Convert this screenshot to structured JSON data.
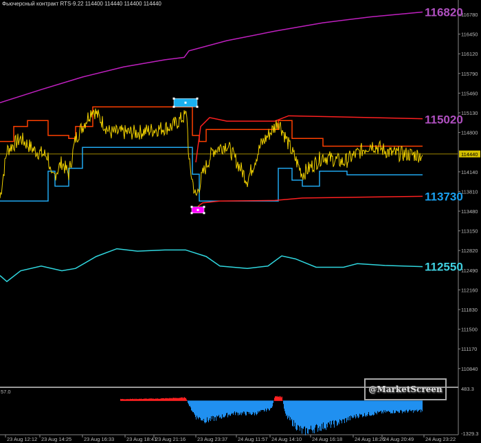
{
  "header": {
    "title": "Фьючерсный контракт RTS-9.22  114400 114440 114400 114440"
  },
  "logo_text": "@MarketScreen",
  "chart_data": {
    "type": "line",
    "title": "Фьючерсный контракт RTS-9.22",
    "x_unit": "bar index",
    "x_ticks": [
      {
        "bar": 8,
        "label": "23 Aug 12:12"
      },
      {
        "bar": 58,
        "label": "23 Aug 14:25"
      },
      {
        "bar": 120,
        "label": "23 Aug 16:33"
      },
      {
        "bar": 182,
        "label": "23 Aug 18:41"
      },
      {
        "bar": 224,
        "label": "23 Aug 21:16"
      },
      {
        "bar": 285,
        "label": "23 Aug 23:37"
      },
      {
        "bar": 344,
        "label": "24 Aug 11:57"
      },
      {
        "bar": 393,
        "label": "24 Aug 14:10"
      },
      {
        "bar": 452,
        "label": "24 Aug 16:18"
      },
      {
        "bar": 514,
        "label": "24 Aug 18:26"
      },
      {
        "bar": 556,
        "label": "24 Aug 20:49"
      },
      {
        "bar": 617,
        "label": "24 Aug 23:22"
      }
    ],
    "y_ticks": [
      116780,
      116450,
      116120,
      115790,
      115460,
      115130,
      114800,
      114140,
      113810,
      113480,
      113150,
      112820,
      112490,
      112160,
      111830,
      111500,
      111170,
      110840
    ],
    "ylim": [
      110500,
      117000
    ],
    "current_price": {
      "value": "114440",
      "color": "#d4c000"
    },
    "level_labels": [
      {
        "text": "116820",
        "value": 116820,
        "color": "#b050c0"
      },
      {
        "text": "115020",
        "value": 115020,
        "color": "#b050c0"
      },
      {
        "text": "113730",
        "value": 113730,
        "color": "#1aa0f0"
      },
      {
        "text": "112550",
        "value": 112550,
        "color": "#40d0e0"
      }
    ],
    "series": [
      {
        "name": "upper-envelope",
        "color": "#c020c0",
        "points": [
          [
            0,
            115300
          ],
          [
            60,
            115520
          ],
          [
            120,
            115730
          ],
          [
            180,
            115900
          ],
          [
            240,
            116020
          ],
          [
            268,
            116060
          ],
          [
            275,
            116170
          ],
          [
            330,
            116340
          ],
          [
            400,
            116500
          ],
          [
            470,
            116640
          ],
          [
            540,
            116740
          ],
          [
            615,
            116820
          ]
        ]
      },
      {
        "name": "lower-envelope",
        "color": "#30d8e0",
        "points": [
          [
            0,
            112400
          ],
          [
            10,
            112300
          ],
          [
            30,
            112480
          ],
          [
            60,
            112560
          ],
          [
            90,
            112480
          ],
          [
            110,
            112520
          ],
          [
            140,
            112720
          ],
          [
            170,
            112850
          ],
          [
            200,
            112810
          ],
          [
            240,
            112830
          ],
          [
            270,
            112830
          ],
          [
            300,
            112720
          ],
          [
            320,
            112560
          ],
          [
            360,
            112520
          ],
          [
            390,
            112560
          ],
          [
            410,
            112730
          ],
          [
            430,
            112680
          ],
          [
            460,
            112540
          ],
          [
            500,
            112540
          ],
          [
            520,
            112600
          ],
          [
            560,
            112570
          ],
          [
            615,
            112550
          ]
        ]
      },
      {
        "name": "resistance-step",
        "color": "#ff4000",
        "step": true,
        "points": [
          [
            0,
            114650
          ],
          [
            20,
            114900
          ],
          [
            40,
            115000
          ],
          [
            70,
            114750
          ],
          [
            100,
            114700
          ],
          [
            110,
            114900
          ],
          [
            135,
            115230
          ],
          [
            272,
            115230
          ],
          [
            280,
            114750
          ],
          [
            290,
            114650
          ],
          [
            300,
            114850
          ],
          [
            400,
            114850
          ],
          [
            405,
            115000
          ],
          [
            425,
            114700
          ],
          [
            470,
            114570
          ],
          [
            615,
            114570
          ]
        ]
      },
      {
        "name": "support-step",
        "color": "#20a8f0",
        "step": true,
        "points": [
          [
            0,
            113650
          ],
          [
            40,
            113650
          ],
          [
            70,
            114150
          ],
          [
            80,
            113900
          ],
          [
            100,
            114200
          ],
          [
            120,
            114550
          ],
          [
            272,
            114550
          ],
          [
            280,
            114100
          ],
          [
            290,
            113650
          ],
          [
            400,
            113650
          ],
          [
            405,
            114200
          ],
          [
            425,
            114000
          ],
          [
            440,
            113900
          ],
          [
            465,
            114150
          ],
          [
            505,
            114090
          ],
          [
            615,
            114090
          ]
        ]
      },
      {
        "name": "upper-channel",
        "color": "#ff2020",
        "points": [
          [
            285,
            114300
          ],
          [
            292,
            114900
          ],
          [
            305,
            115050
          ],
          [
            330,
            114990
          ],
          [
            400,
            114990
          ],
          [
            420,
            115080
          ],
          [
            615,
            115030
          ]
        ]
      },
      {
        "name": "lower-channel",
        "color": "#ff2020",
        "points": [
          [
            288,
            113560
          ],
          [
            295,
            113620
          ],
          [
            320,
            113650
          ],
          [
            400,
            113660
          ],
          [
            440,
            113700
          ],
          [
            615,
            113730
          ]
        ]
      },
      {
        "name": "price",
        "color": "#f0d000",
        "points": [
          [
            0,
            113700
          ],
          [
            10,
            114500
          ],
          [
            30,
            114700
          ],
          [
            50,
            114500
          ],
          [
            70,
            114400
          ],
          [
            75,
            114000
          ],
          [
            90,
            114300
          ],
          [
            100,
            114100
          ],
          [
            110,
            114700
          ],
          [
            135,
            115200
          ],
          [
            160,
            114800
          ],
          [
            200,
            114800
          ],
          [
            250,
            114900
          ],
          [
            272,
            115100
          ],
          [
            275,
            114300
          ],
          [
            285,
            113700
          ],
          [
            295,
            114100
          ],
          [
            310,
            114500
          ],
          [
            330,
            114600
          ],
          [
            360,
            114000
          ],
          [
            380,
            114600
          ],
          [
            400,
            114900
          ],
          [
            405,
            115000
          ],
          [
            420,
            114600
          ],
          [
            440,
            114100
          ],
          [
            470,
            114400
          ],
          [
            500,
            114300
          ],
          [
            540,
            114600
          ],
          [
            570,
            114450
          ],
          [
            615,
            114420
          ]
        ]
      }
    ],
    "markers": [
      {
        "name": "buy-marker",
        "bar": 270,
        "value": 115300,
        "color": "#1ab0f0"
      },
      {
        "name": "sell-marker",
        "bar": 288,
        "value": 113500,
        "color": "#ff00ff"
      }
    ],
    "sub_window": {
      "type": "area",
      "y_top_label": "483.3",
      "y_bottom_label": "-1329.3",
      "left_label": "57.0",
      "ylim": [
        -1329.3,
        483.3
      ],
      "points": [
        [
          175,
          60
        ],
        [
          230,
          80
        ],
        [
          270,
          120
        ],
        [
          275,
          -200
        ],
        [
          285,
          -650
        ],
        [
          300,
          -800
        ],
        [
          320,
          -650
        ],
        [
          340,
          -500
        ],
        [
          370,
          -520
        ],
        [
          395,
          -300
        ],
        [
          400,
          200
        ],
        [
          410,
          150
        ],
        [
          415,
          -600
        ],
        [
          430,
          -1000
        ],
        [
          440,
          -1250
        ],
        [
          460,
          -1100
        ],
        [
          490,
          -900
        ],
        [
          520,
          -600
        ],
        [
          560,
          -450
        ],
        [
          615,
          -400
        ]
      ]
    }
  }
}
